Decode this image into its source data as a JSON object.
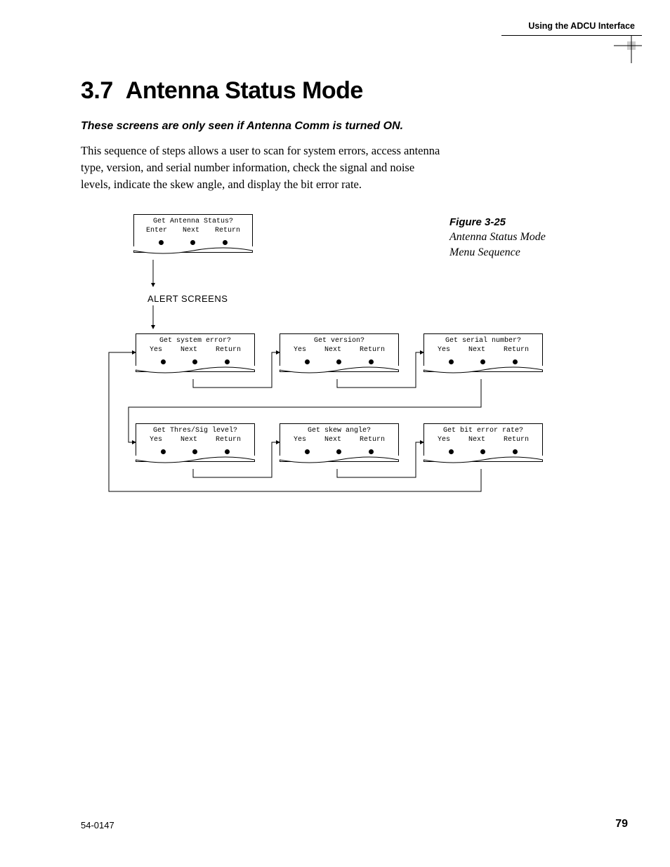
{
  "header": {
    "running_head": "Using the ADCU Interface"
  },
  "section": {
    "number": "3.7",
    "title": "Antenna Status Mode",
    "subheading": "These screens are only seen if Antenna Comm is turned ON.",
    "body": "This sequence of steps allows a user to scan for system errors, access antenna type, version, and serial number information, check the signal and noise levels, indicate the skew angle, and display the bit error rate."
  },
  "figure": {
    "number": "Figure 3-25",
    "title_l1": "Antenna Status Mode",
    "title_l2": "Menu Sequence",
    "alert_label": "ALERT SCREENS",
    "top_box": {
      "title": "Get Antenna Status?",
      "b1": "Enter",
      "b2": "Next",
      "b3": "Return"
    },
    "row1": [
      {
        "title": "Get system error?",
        "b1": "Yes",
        "b2": "Next",
        "b3": "Return"
      },
      {
        "title": "Get version?",
        "b1": "Yes",
        "b2": "Next",
        "b3": "Return"
      },
      {
        "title": "Get serial number?",
        "b1": "Yes",
        "b2": "Next",
        "b3": "Return"
      }
    ],
    "row2": [
      {
        "title": "Get Thres/Sig level?",
        "b1": "Yes",
        "b2": "Next",
        "b3": "Return"
      },
      {
        "title": "Get skew angle?",
        "b1": "Yes",
        "b2": "Next",
        "b3": "Return"
      },
      {
        "title": "Get bit error rate?",
        "b1": "Yes",
        "b2": "Next",
        "b3": "Return"
      }
    ]
  },
  "footer": {
    "doc_id": "54-0147",
    "page": "79"
  }
}
